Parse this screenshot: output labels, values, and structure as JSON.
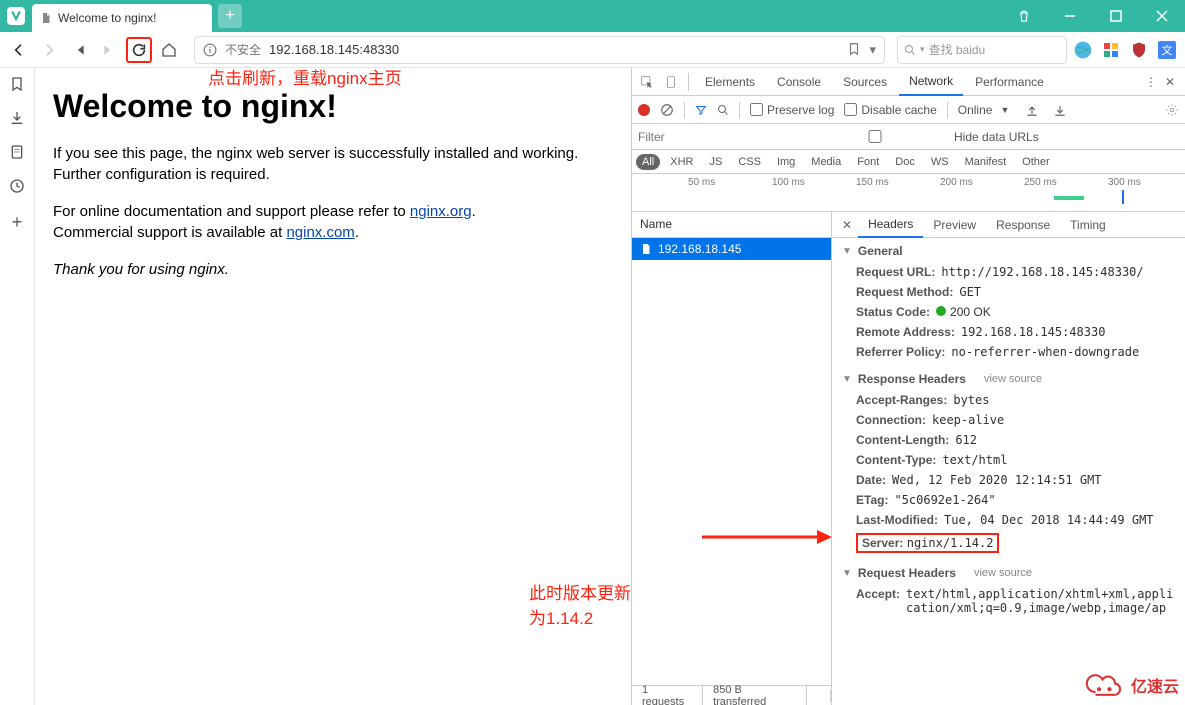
{
  "tab": {
    "title": "Welcome to nginx!"
  },
  "nav": {
    "insecure": "不安全",
    "url": "192.168.18.145:48330",
    "search_placeholder": "查找 baidu"
  },
  "annotations": {
    "refresh": "点击刷新，重载nginx主页",
    "version": "此时版本更新为1.14.2"
  },
  "page": {
    "h1": "Welcome to nginx!",
    "p1a": "If you see this page, the nginx web server is successfully installed and working. Further configuration is required.",
    "p2a": "For online documentation and support please refer to ",
    "link1": "nginx.org",
    "p2b": ".",
    "p2c": "Commercial support is available at ",
    "link2": "nginx.com",
    "p2d": ".",
    "p3": "Thank you for using nginx."
  },
  "devtools": {
    "tabs": {
      "elements": "Elements",
      "console": "Console",
      "sources": "Sources",
      "network": "Network",
      "performance": "Performance"
    },
    "toolbar": {
      "preserve": "Preserve log",
      "disable": "Disable cache",
      "online": "Online"
    },
    "filter_placeholder": "Filter",
    "hide_urls": "Hide data URLs",
    "types": {
      "all": "All",
      "xhr": "XHR",
      "js": "JS",
      "css": "CSS",
      "img": "Img",
      "media": "Media",
      "font": "Font",
      "doc": "Doc",
      "ws": "WS",
      "manifest": "Manifest",
      "other": "Other"
    },
    "timeline": {
      "t50": "50 ms",
      "t100": "100 ms",
      "t150": "150 ms",
      "t200": "200 ms",
      "t250": "250 ms",
      "t300": "300 ms"
    },
    "name_hdr": "Name",
    "req_row": "192.168.18.145",
    "dtabs": {
      "headers": "Headers",
      "preview": "Preview",
      "response": "Response",
      "timing": "Timing"
    },
    "general_label": "General",
    "general": {
      "url_k": "Request URL:",
      "url_v": "http://192.168.18.145:48330/",
      "method_k": "Request Method:",
      "method_v": "GET",
      "status_k": "Status Code:",
      "status_v": "200 OK",
      "remote_k": "Remote Address:",
      "remote_v": "192.168.18.145:48330",
      "ref_k": "Referrer Policy:",
      "ref_v": "no-referrer-when-downgrade"
    },
    "resp_label": "Response Headers",
    "view_source": "view source",
    "resp": {
      "ar_k": "Accept-Ranges:",
      "ar_v": "bytes",
      "conn_k": "Connection:",
      "conn_v": "keep-alive",
      "cl_k": "Content-Length:",
      "cl_v": "612",
      "ct_k": "Content-Type:",
      "ct_v": "text/html",
      "date_k": "Date:",
      "date_v": "Wed, 12 Feb 2020 12:14:51 GMT",
      "etag_k": "ETag:",
      "etag_v": "\"5c0692e1-264\"",
      "lm_k": "Last-Modified:",
      "lm_v": "Tue, 04 Dec 2018 14:44:49 GMT",
      "srv_k": "Server:",
      "srv_v": "nginx/1.14.2"
    },
    "req_label": "Request Headers",
    "req": {
      "acc_k": "Accept:",
      "acc_v": "text/html,application/xhtml+xml,application/xml;q=0.9,image/webp,image/ap"
    },
    "footer": {
      "reqs": "1 requests",
      "bytes": "850 B transferred"
    }
  },
  "watermark": "亿速云"
}
